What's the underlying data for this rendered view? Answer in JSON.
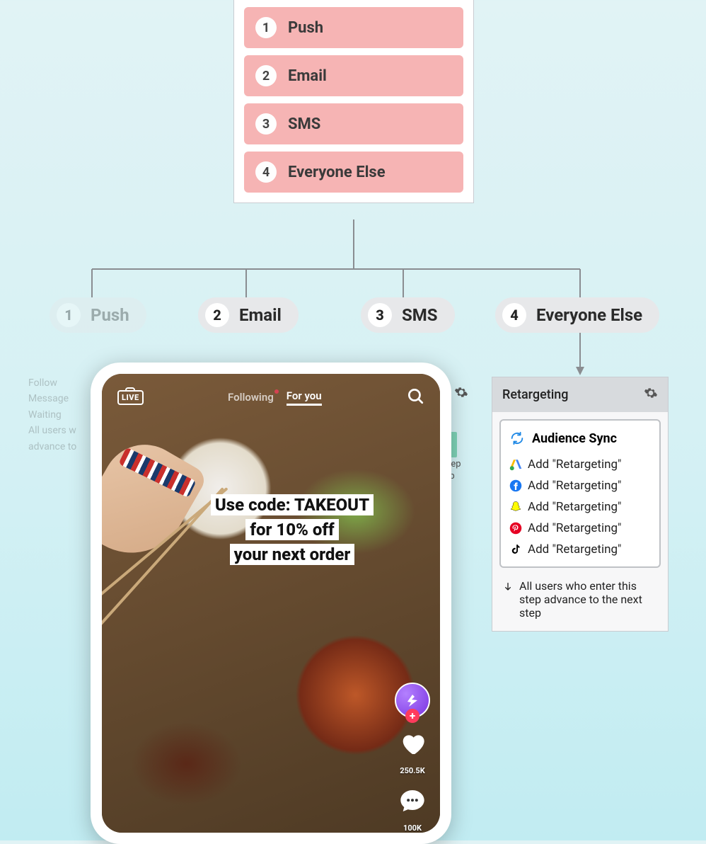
{
  "channels": [
    {
      "num": "1",
      "label": "Push"
    },
    {
      "num": "2",
      "label": "Email"
    },
    {
      "num": "3",
      "label": "SMS"
    },
    {
      "num": "4",
      "label": "Everyone Else"
    }
  ],
  "branches": [
    {
      "num": "1",
      "label": "Push"
    },
    {
      "num": "2",
      "label": "Email"
    },
    {
      "num": "3",
      "label": "SMS"
    },
    {
      "num": "4",
      "label": "Everyone Else"
    }
  ],
  "retargeting": {
    "title": "Retargeting",
    "sync_label": "Audience Sync",
    "providers": [
      {
        "icon": "google",
        "label": "Add \"Retargeting\""
      },
      {
        "icon": "facebook",
        "label": "Add \"Retargeting\""
      },
      {
        "icon": "snapchat",
        "label": "Add \"Retargeting\""
      },
      {
        "icon": "pinterest",
        "label": "Add \"Retargeting\""
      },
      {
        "icon": "tiktok",
        "label": "Add \"Retargeting\""
      }
    ],
    "footer": "All users who enter this step advance to the next step"
  },
  "tiktok": {
    "live": "LIVE",
    "following": "Following",
    "foryou": "For you",
    "promo_line1": "Use code: TAKEOUT",
    "promo_line2": "for 10% off",
    "promo_line3": "your next order",
    "like_count": "250.5K",
    "comment_count": "100K"
  },
  "behind": {
    "line1": "step",
    "line2": "p"
  },
  "faded_panel": {
    "l1": "Follow",
    "l2": "Message",
    "l3": "Waiting",
    "l4": "All users w",
    "l5": "advance to"
  }
}
